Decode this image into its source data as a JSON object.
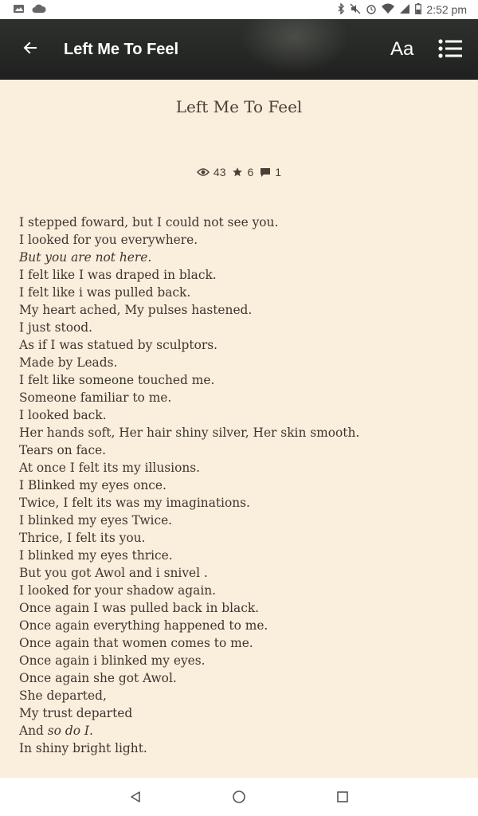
{
  "status_bar": {
    "time": "2:52 pm",
    "left_icons": [
      "image-icon",
      "cloud-icon"
    ],
    "right_icons": [
      "bluetooth-icon",
      "mute-icon",
      "alarm-icon",
      "wifi-icon",
      "signal-icon",
      "battery-icon"
    ]
  },
  "app_bar": {
    "title": "Left Me To Feel",
    "font_button_label": "Aa"
  },
  "story": {
    "title": "Left Me To Feel",
    "stats": {
      "views": "43",
      "votes": "6",
      "comments": "1"
    },
    "lines": [
      {
        "pre": "I stepped foward, but I could not see you.",
        "em": "",
        "post": ""
      },
      {
        "pre": "I looked for you everywhere.",
        "em": "",
        "post": ""
      },
      {
        "pre": "",
        "em": "But you are not here.",
        "post": ""
      },
      {
        "pre": "I felt like I was draped in black.",
        "em": "",
        "post": ""
      },
      {
        "pre": "I felt like i was pulled back.",
        "em": "",
        "post": ""
      },
      {
        "pre": "My heart ached, My pulses hastened.",
        "em": "",
        "post": ""
      },
      {
        "pre": "I just stood.",
        "em": "",
        "post": ""
      },
      {
        "pre": "As if I was statued by sculptors.",
        "em": "",
        "post": ""
      },
      {
        "pre": "Made by Leads.",
        "em": "",
        "post": ""
      },
      {
        "pre": "I felt like someone touched me.",
        "em": "",
        "post": ""
      },
      {
        "pre": "Someone familiar to me.",
        "em": "",
        "post": ""
      },
      {
        "pre": "I looked back.",
        "em": "",
        "post": ""
      },
      {
        "pre": "Her hands soft, Her hair shiny silver, Her skin smooth.",
        "em": "",
        "post": ""
      },
      {
        "pre": "Tears on face.",
        "em": "",
        "post": ""
      },
      {
        "pre": "At once I felt its my illusions.",
        "em": "",
        "post": ""
      },
      {
        "pre": "I Blinked my eyes once.",
        "em": "",
        "post": ""
      },
      {
        "pre": "Twice, I felt its was my imaginations.",
        "em": "",
        "post": ""
      },
      {
        "pre": "I blinked my eyes Twice.",
        "em": "",
        "post": ""
      },
      {
        "pre": "Thrice, I felt its you.",
        "em": "",
        "post": ""
      },
      {
        "pre": "I blinked my eyes thrice.",
        "em": "",
        "post": ""
      },
      {
        "pre": "But you got Awol and i snivel .",
        "em": "",
        "post": ""
      },
      {
        "pre": "I looked for your shadow again.",
        "em": "",
        "post": ""
      },
      {
        "pre": "Once again I was pulled back in black.",
        "em": "",
        "post": ""
      },
      {
        "pre": "Once again everything happened to me.",
        "em": "",
        "post": ""
      },
      {
        "pre": "Once again that women comes to me.",
        "em": "",
        "post": ""
      },
      {
        "pre": "Once again i blinked my eyes.",
        "em": "",
        "post": ""
      },
      {
        "pre": "Once again she got Awol.",
        "em": "",
        "post": ""
      },
      {
        "pre": "She departed,",
        "em": "",
        "post": ""
      },
      {
        "pre": "My trust departed",
        "em": "",
        "post": ""
      },
      {
        "pre": "And ",
        "em": "so do I",
        "post": "."
      },
      {
        "pre": "In shiny bright light.",
        "em": "",
        "post": ""
      }
    ]
  },
  "nav_bar": {
    "buttons": [
      "back-triangle-icon",
      "home-circle-icon",
      "recents-square-icon"
    ]
  }
}
